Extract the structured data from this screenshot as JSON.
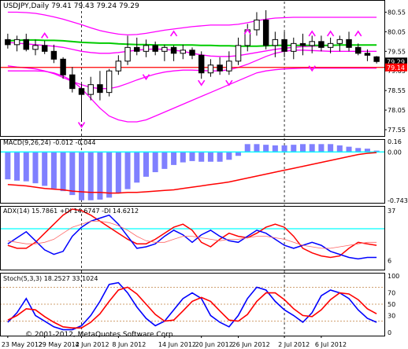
{
  "colors": {
    "background": "#ffffff",
    "frame": "#000000",
    "grid": "#c0c0c0",
    "bullCandle": "#ffffff",
    "bearCandle": "#000000",
    "envelope": "#ff00ff",
    "ma": "#00cc00",
    "askLine": "#ff0000",
    "priceTagBg": "#000000",
    "priceTagFg": "#ffffff",
    "priceTagRed": "#ff0000",
    "macdHist": "#8080ff",
    "macdSignal": "#ff0000",
    "macdZero": "#00ffff",
    "adxLine": "#00ffff",
    "plusDI": "#ff0000",
    "minusDI": "#0000ff",
    "adxMain": "#ff6666",
    "stochMain": "#0000ff",
    "stochSignal": "#ff0000",
    "stochLevel": "#c08040",
    "divider": "#00ffff"
  },
  "chart_data": [
    {
      "type": "candlestick",
      "pane": "main",
      "title": "USDJPY,Daily 79.41 79.43 79.24 79.29",
      "price_tags": [
        "79.29",
        "79.14"
      ],
      "ask_price": 79.14,
      "ylim": [
        77.55,
        80.7
      ],
      "yticks": [
        "80.55",
        "80.05",
        "79.55",
        "79.05",
        "78.55",
        "78.05",
        "77.55"
      ],
      "candles": [
        {
          "o": 79.85,
          "h": 80.0,
          "l": 79.62,
          "c": 79.72
        },
        {
          "o": 79.72,
          "h": 79.95,
          "l": 79.55,
          "c": 79.85
        },
        {
          "o": 79.85,
          "h": 80.0,
          "l": 79.55,
          "c": 79.6
        },
        {
          "o": 79.6,
          "h": 79.85,
          "l": 79.45,
          "c": 79.7
        },
        {
          "o": 79.7,
          "h": 79.82,
          "l": 79.48,
          "c": 79.55
        },
        {
          "o": 79.55,
          "h": 79.72,
          "l": 79.25,
          "c": 79.35
        },
        {
          "o": 79.35,
          "h": 79.4,
          "l": 78.85,
          "c": 78.95
        },
        {
          "o": 78.95,
          "h": 79.15,
          "l": 78.5,
          "c": 78.6
        },
        {
          "o": 78.6,
          "h": 78.72,
          "l": 77.75,
          "c": 78.45
        },
        {
          "o": 78.45,
          "h": 78.9,
          "l": 78.3,
          "c": 78.7
        },
        {
          "o": 78.7,
          "h": 79.05,
          "l": 78.3,
          "c": 78.5
        },
        {
          "o": 78.5,
          "h": 79.1,
          "l": 78.4,
          "c": 79.05
        },
        {
          "o": 79.05,
          "h": 79.45,
          "l": 78.95,
          "c": 79.3
        },
        {
          "o": 79.3,
          "h": 79.95,
          "l": 79.2,
          "c": 79.65
        },
        {
          "o": 79.65,
          "h": 79.9,
          "l": 79.45,
          "c": 79.55
        },
        {
          "o": 79.55,
          "h": 79.85,
          "l": 79.4,
          "c": 79.7
        },
        {
          "o": 79.7,
          "h": 79.8,
          "l": 79.45,
          "c": 79.55
        },
        {
          "o": 79.55,
          "h": 79.72,
          "l": 79.3,
          "c": 79.65
        },
        {
          "o": 79.65,
          "h": 79.7,
          "l": 79.3,
          "c": 79.5
        },
        {
          "o": 79.5,
          "h": 79.72,
          "l": 79.35,
          "c": 79.58
        },
        {
          "o": 79.58,
          "h": 79.65,
          "l": 79.35,
          "c": 79.45
        },
        {
          "o": 79.45,
          "h": 79.55,
          "l": 78.85,
          "c": 79.0
        },
        {
          "o": 79.0,
          "h": 79.35,
          "l": 78.9,
          "c": 79.2
        },
        {
          "o": 79.2,
          "h": 79.4,
          "l": 78.95,
          "c": 79.05
        },
        {
          "o": 79.05,
          "h": 79.55,
          "l": 78.95,
          "c": 79.3
        },
        {
          "o": 79.3,
          "h": 79.9,
          "l": 79.2,
          "c": 79.7
        },
        {
          "o": 79.7,
          "h": 80.25,
          "l": 79.55,
          "c": 80.1
        },
        {
          "o": 80.1,
          "h": 80.55,
          "l": 79.95,
          "c": 80.35
        },
        {
          "o": 80.35,
          "h": 80.6,
          "l": 79.6,
          "c": 79.7
        },
        {
          "o": 79.7,
          "h": 80.05,
          "l": 79.4,
          "c": 79.85
        },
        {
          "o": 79.85,
          "h": 80.05,
          "l": 79.4,
          "c": 79.55
        },
        {
          "o": 79.55,
          "h": 79.9,
          "l": 79.35,
          "c": 79.75
        },
        {
          "o": 79.75,
          "h": 80.0,
          "l": 79.45,
          "c": 79.7
        },
        {
          "o": 79.7,
          "h": 79.95,
          "l": 79.5,
          "c": 79.8
        },
        {
          "o": 79.8,
          "h": 79.95,
          "l": 79.55,
          "c": 79.65
        },
        {
          "o": 79.65,
          "h": 79.9,
          "l": 79.5,
          "c": 79.75
        },
        {
          "o": 79.75,
          "h": 79.95,
          "l": 79.55,
          "c": 79.85
        },
        {
          "o": 79.85,
          "h": 80.05,
          "l": 79.55,
          "c": 79.65
        },
        {
          "o": 79.65,
          "h": 79.75,
          "l": 79.45,
          "c": 79.5
        },
        {
          "o": 79.5,
          "h": 79.6,
          "l": 79.3,
          "c": 79.45
        },
        {
          "o": 79.41,
          "h": 79.43,
          "l": 79.24,
          "c": 79.29
        }
      ],
      "ma": [
        79.82,
        79.83,
        79.84,
        79.84,
        79.83,
        79.83,
        79.82,
        79.8,
        79.78,
        79.77,
        79.76,
        79.76,
        79.74,
        79.73,
        79.72,
        79.72,
        79.71,
        79.71,
        79.71,
        79.71,
        79.71,
        79.7,
        79.7,
        79.69,
        79.69,
        79.68,
        79.68,
        79.68,
        79.69,
        79.7,
        79.7,
        79.7,
        79.7,
        79.7,
        79.7,
        79.7,
        79.71,
        79.71,
        79.71,
        79.71,
        79.71
      ],
      "env_outer_upper": [
        80.55,
        80.55,
        80.54,
        80.52,
        80.48,
        80.43,
        80.37,
        80.3,
        80.23,
        80.15,
        80.08,
        80.03,
        79.99,
        79.97,
        79.98,
        80.01,
        80.05,
        80.09,
        80.12,
        80.15,
        80.18,
        80.2,
        80.22,
        80.22,
        80.22,
        80.24,
        80.28,
        80.33,
        80.37,
        80.4,
        80.41,
        80.42,
        80.42,
        80.42,
        80.42,
        80.42,
        80.42,
        80.42,
        80.42,
        80.42,
        80.42
      ],
      "env_inner_upper": [
        79.78,
        79.76,
        79.74,
        79.72,
        79.7,
        79.68,
        79.65,
        79.6,
        79.55,
        79.52,
        79.5,
        79.5,
        79.52,
        79.55,
        79.58,
        79.6,
        79.61,
        79.6,
        79.58,
        79.55,
        79.5,
        79.46,
        79.43,
        79.42,
        79.42,
        79.44,
        79.48,
        79.52,
        79.56,
        79.6,
        79.63,
        79.65,
        79.67,
        79.68,
        79.69,
        79.7,
        79.71,
        79.71,
        79.71,
        79.71,
        79.71
      ],
      "env_inner_lower": [
        79.18,
        79.15,
        79.13,
        79.1,
        79.05,
        78.98,
        78.88,
        78.78,
        78.7,
        78.63,
        78.6,
        78.6,
        78.65,
        78.73,
        78.82,
        78.9,
        78.97,
        79.02,
        79.05,
        79.07,
        79.07,
        79.06,
        79.05,
        79.05,
        79.08,
        79.14,
        79.22,
        79.32,
        79.42,
        79.5,
        79.55,
        79.58,
        79.58,
        79.57,
        79.56,
        79.55,
        79.55,
        79.55,
        79.55,
        79.55,
        79.55
      ],
      "env_outer_lower": [
        79.05,
        79.05,
        79.05,
        79.05,
        79.04,
        79.0,
        78.92,
        78.8,
        78.6,
        78.35,
        78.1,
        77.9,
        77.8,
        77.75,
        77.75,
        77.8,
        77.9,
        78.0,
        78.1,
        78.2,
        78.3,
        78.4,
        78.5,
        78.6,
        78.7,
        78.8,
        78.9,
        79.0,
        79.05,
        79.08,
        79.1,
        79.11,
        79.12,
        79.12,
        79.12,
        79.12,
        79.12,
        79.12,
        79.12,
        79.12,
        79.12
      ],
      "arrows_up": [
        [
          4,
          79.95
        ],
        [
          18,
          80.0
        ],
        [
          26,
          80.05
        ],
        [
          33,
          80.0
        ],
        [
          35,
          80.0
        ],
        [
          38,
          80.0
        ]
      ],
      "arrows_down": [
        [
          8,
          77.68
        ],
        [
          15,
          78.9
        ],
        [
          21,
          78.75
        ],
        [
          24,
          78.75
        ],
        [
          33,
          79.12
        ]
      ],
      "date_labels": [
        "23 May 2012",
        "29 May 2012",
        "4 Jun 2012",
        "8 Jun 2012",
        "14 Jun 2012",
        "20 Jun 2012",
        "26 Jun 2012",
        "2 Jul 2012",
        "6 Jul 2012"
      ],
      "date_label_index": [
        0,
        4,
        8,
        12,
        17,
        21,
        25,
        30,
        34
      ],
      "vlines_index": [
        8,
        30
      ]
    },
    {
      "type": "bar",
      "pane": "macd",
      "title": "MACD(9,26,24) -0.012 -0.044",
      "ylim": [
        -0.743,
        0.16
      ],
      "yticks": [
        "0.16",
        "0.00",
        "-0.743"
      ],
      "values": [
        -0.42,
        -0.44,
        -0.45,
        -0.48,
        -0.52,
        -0.56,
        -0.6,
        -0.66,
        -0.74,
        -0.74,
        -0.73,
        -0.7,
        -0.63,
        -0.57,
        -0.47,
        -0.38,
        -0.31,
        -0.26,
        -0.2,
        -0.16,
        -0.14,
        -0.15,
        -0.15,
        -0.15,
        -0.12,
        -0.06,
        0.12,
        0.12,
        0.11,
        0.1,
        0.1,
        0.11,
        0.12,
        0.12,
        0.12,
        0.12,
        0.1,
        0.08,
        0.06,
        0.05,
        0.02
      ],
      "signal": [
        -0.5,
        -0.51,
        -0.52,
        -0.54,
        -0.56,
        -0.57,
        -0.58,
        -0.6,
        -0.61,
        -0.62,
        -0.62,
        -0.63,
        -0.63,
        -0.62,
        -0.62,
        -0.61,
        -0.6,
        -0.59,
        -0.58,
        -0.56,
        -0.54,
        -0.52,
        -0.5,
        -0.48,
        -0.46,
        -0.43,
        -0.4,
        -0.37,
        -0.34,
        -0.31,
        -0.28,
        -0.25,
        -0.22,
        -0.19,
        -0.16,
        -0.13,
        -0.1,
        -0.07,
        -0.04,
        -0.02,
        -0.01
      ]
    },
    {
      "type": "line",
      "pane": "adx",
      "title": "ADX(14) 15.7861 +DI 14.6747 -DI 14.6212",
      "ylim": [
        0,
        38
      ],
      "yticks": [
        "37",
        "",
        "6"
      ],
      "level": 25,
      "series": [
        {
          "name": "+DI",
          "values": [
            14,
            12,
            12,
            16,
            22,
            28,
            34,
            38,
            37,
            34,
            30,
            26,
            22,
            18,
            15,
            15,
            18,
            22,
            26,
            28,
            24,
            16,
            13,
            18,
            22,
            20,
            19,
            22,
            26,
            28,
            26,
            20,
            12,
            9,
            7,
            6,
            7,
            12,
            16,
            15,
            14
          ]
        },
        {
          "name": "-DI",
          "values": [
            15,
            19,
            23,
            17,
            11,
            8,
            10,
            20,
            26,
            30,
            32,
            34,
            28,
            20,
            12,
            13,
            15,
            20,
            24,
            21,
            16,
            21,
            24,
            20,
            17,
            16,
            20,
            24,
            22,
            18,
            14,
            12,
            14,
            16,
            14,
            10,
            8,
            6,
            5,
            6,
            6
          ]
        },
        {
          "name": "ADX",
          "values": [
            17,
            16,
            15,
            15,
            16,
            18,
            22,
            26,
            28,
            30,
            30,
            29,
            27,
            24,
            20,
            17,
            16,
            16,
            18,
            20,
            20,
            19,
            18,
            17,
            18,
            18,
            19,
            20,
            20,
            19,
            18,
            16,
            14,
            13,
            12,
            12,
            13,
            14,
            15,
            16,
            16
          ]
        }
      ]
    },
    {
      "type": "line",
      "pane": "stoch",
      "title": "Stoch(5,3,3) 18.2527 33.1024",
      "ylim": [
        0,
        100
      ],
      "yticks": [
        "100",
        "70",
        "50",
        "30",
        "0"
      ],
      "levels": [
        80,
        50,
        20
      ],
      "series": [
        {
          "name": "%K",
          "values": [
            18,
            35,
            60,
            30,
            20,
            10,
            5,
            5,
            12,
            30,
            55,
            85,
            88,
            70,
            45,
            25,
            12,
            20,
            40,
            60,
            70,
            60,
            30,
            18,
            10,
            30,
            60,
            80,
            75,
            55,
            40,
            30,
            18,
            35,
            65,
            75,
            70,
            60,
            40,
            25,
            18
          ]
        },
        {
          "name": "%D",
          "values": [
            22,
            30,
            42,
            40,
            28,
            18,
            10,
            8,
            8,
            18,
            33,
            55,
            75,
            80,
            68,
            50,
            32,
            20,
            22,
            38,
            55,
            62,
            55,
            38,
            22,
            20,
            32,
            55,
            70,
            70,
            58,
            42,
            30,
            28,
            40,
            58,
            70,
            68,
            58,
            42,
            33
          ]
        }
      ]
    }
  ],
  "copyright": "© 2001-2012, MetaQuotes Software Corp."
}
